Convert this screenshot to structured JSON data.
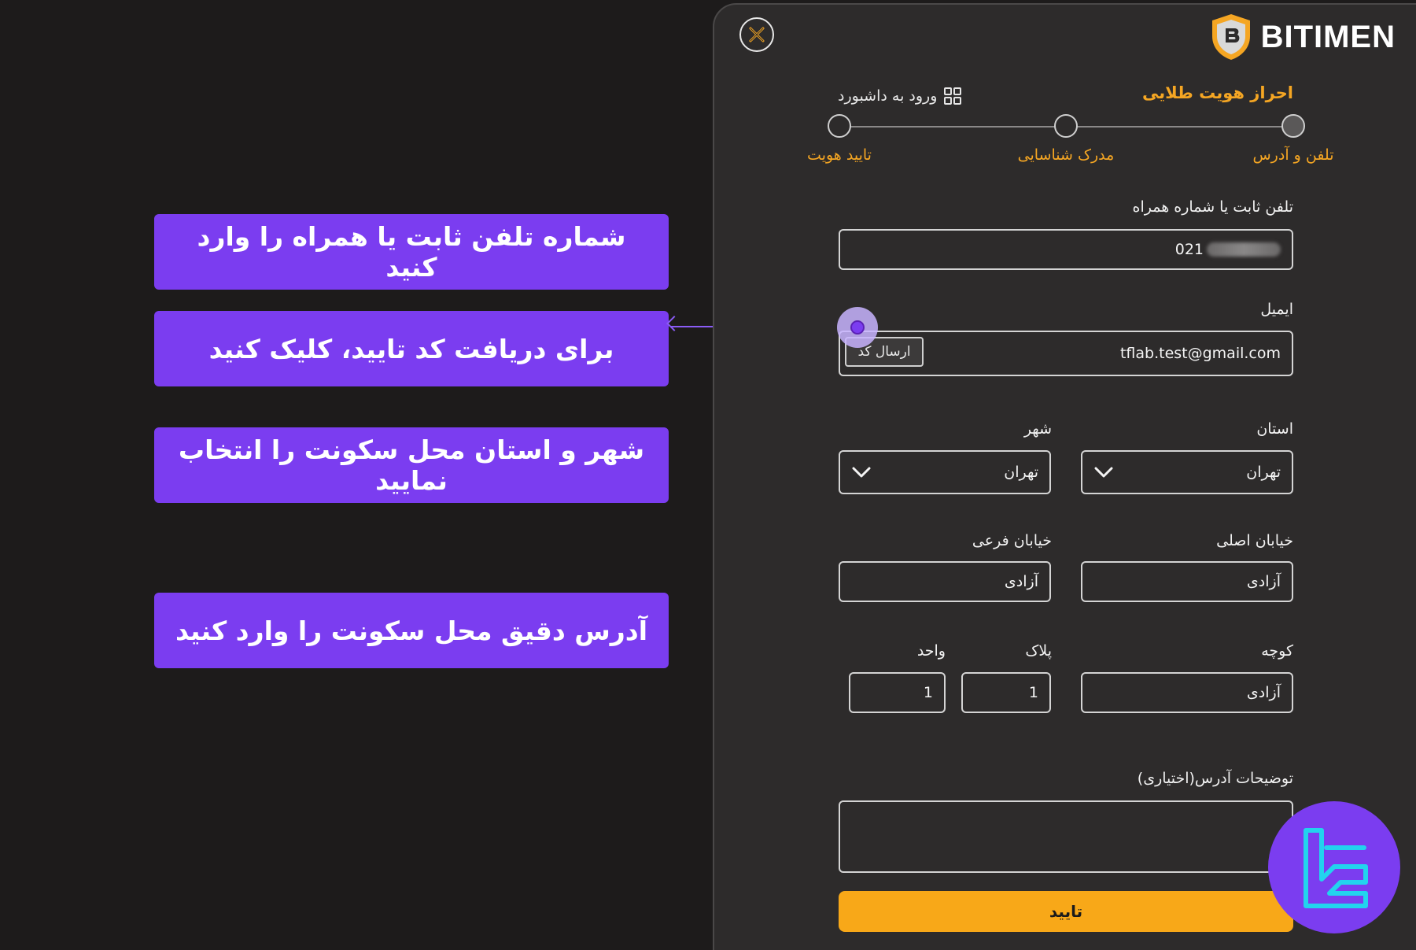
{
  "callouts": {
    "phone": "شماره تلفن ثابت یا همراه را وارد کنید",
    "verify": "برای دریافت کد تایید، کلیک کنید",
    "city": "شهر و استان محل سکونت را انتخاب نمایید",
    "address": "آدرس دقیق محل سکونت را وارد کنید"
  },
  "brand": {
    "name": "BITIMEN"
  },
  "header": {
    "title": "احراز هویت طلایی",
    "dashboard_link": "ورود به داشبورد"
  },
  "stepper": {
    "steps": [
      "تلفن و آدرس",
      "مدرک شناسایی",
      "تایید هویت"
    ],
    "current": 1
  },
  "form": {
    "phone_label": "تلفن ثابت یا شماره همراه",
    "phone_value": "021",
    "email_label": "ایمیل",
    "email_value": "tflab.test@gmail.com",
    "send_code_label": "ارسال کد",
    "province_label": "استان",
    "province_value": "تهران",
    "city_label": "شهر",
    "city_value": "تهران",
    "main_street_label": "خیابان اصلی",
    "main_street_value": "آزادی",
    "side_street_label": "خیابان فرعی",
    "side_street_value": "آزادی",
    "alley_label": "کوچه",
    "alley_value": "آزادی",
    "plaque_label": "پلاک",
    "plaque_value": "1",
    "unit_label": "واحد",
    "unit_value": "1",
    "notes_label": "توضیحات آدرس(اختیاری)",
    "notes_value": "",
    "submit_label": "تایید"
  },
  "colors": {
    "accent_gold": "#f5a623",
    "callout_purple": "#7b3df0",
    "panel_bg": "#2d2b2b",
    "page_bg": "#1d1b1b"
  },
  "icons": {
    "close": "close-icon",
    "logo": "bitimen-shield-logo",
    "dashboard": "grid-icon",
    "select": "chevron-down-icon",
    "badge": "tf-logo-icon"
  }
}
